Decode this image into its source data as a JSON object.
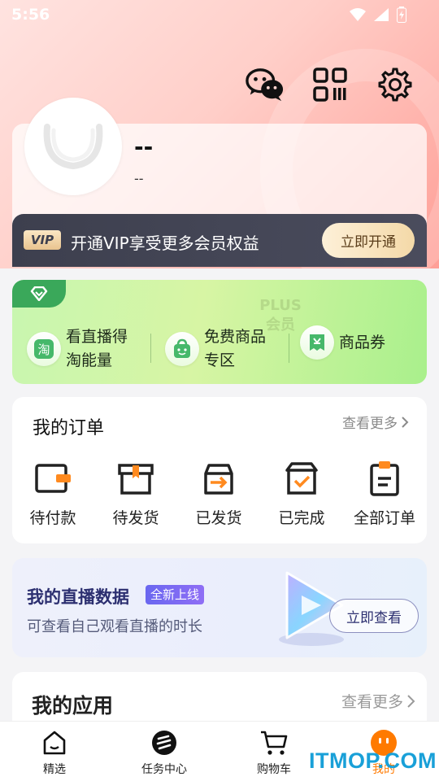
{
  "status_bar": {
    "time": "5:56"
  },
  "top_icons": [
    "wechat-icon",
    "qrcode-icon",
    "settings-icon"
  ],
  "profile": {
    "nickname": "--",
    "subtitle": "--"
  },
  "vip": {
    "logo": "VIP",
    "text": "开通VIP享受更多会员权益",
    "button": "立即开通"
  },
  "plus": {
    "watermark": [
      "PLUS",
      "会员"
    ],
    "items": [
      {
        "label": "看直播得淘能量",
        "icon": "tao-icon"
      },
      {
        "label": "免费商品专区",
        "icon": "bag-icon"
      },
      {
        "label": "商品券",
        "icon": "coupon-icon"
      }
    ]
  },
  "orders": {
    "title": "我的订单",
    "more": "查看更多",
    "items": [
      {
        "label": "待付款",
        "icon": "wallet-icon"
      },
      {
        "label": "待发货",
        "icon": "package-icon"
      },
      {
        "label": "已发货",
        "icon": "shipped-icon"
      },
      {
        "label": "已完成",
        "icon": "completed-icon"
      },
      {
        "label": "全部订单",
        "icon": "order-list-icon"
      }
    ]
  },
  "live_data": {
    "title": "我的直播数据",
    "badge": "全新上线",
    "subtitle": "可查看自己观看直播的时长",
    "button": "立即查看"
  },
  "apps": {
    "title": "我的应用",
    "more": "查看更多"
  },
  "tabbar": {
    "items": [
      {
        "label": "精选",
        "icon": "home-icon"
      },
      {
        "label": "任务中心",
        "icon": "task-icon"
      },
      {
        "label": "购物车",
        "icon": "cart-icon"
      },
      {
        "label": "我的",
        "icon": "profile-icon"
      }
    ]
  },
  "watermark": "ITMOP.COM",
  "colors": {
    "accent_pink": "#ff9f97",
    "plus_green": "#3aa85a",
    "vip_dark": "#3d3f4e",
    "live_indigo": "#2c2f70"
  }
}
